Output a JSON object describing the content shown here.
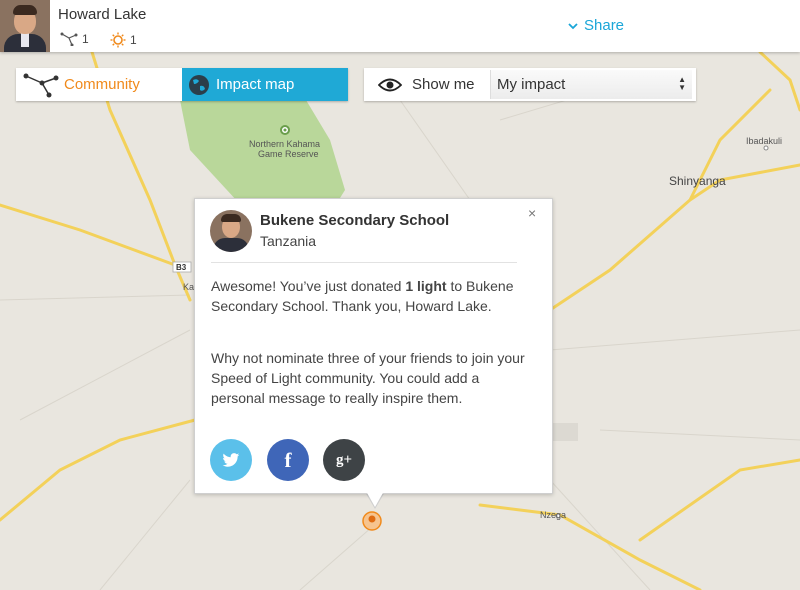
{
  "header": {
    "user_name": "Howard Lake",
    "community_count": "1",
    "lights_count": "1",
    "share_label": "Share"
  },
  "tabs": {
    "community_label": "Community",
    "impact_map_label": "Impact map"
  },
  "show_me": {
    "label": "Show me",
    "selected": "My impact"
  },
  "map_labels": {
    "reserve_line1": "Northern Kahama",
    "reserve_line2": "Game Reserve",
    "shinyanga": "Shinyanga",
    "ibadakuli": "Ibadakuli",
    "nzega": "Nzega",
    "road_b3": "B3",
    "ka": "Ka"
  },
  "popup": {
    "title": "Bukene Secondary School",
    "country": "Tanzania",
    "msg_prefix": "Awesome! You’ve just donated ",
    "msg_bold": "1 light",
    "msg_suffix": " to Bukene Secondary School. Thank you, Howard Lake.",
    "msg2": "Why not nominate three of your friends to join your Speed of Light community. You could add a personal message to really inspire them.",
    "close_glyph": "×",
    "fb_glyph": "f",
    "gp_glyph": "g+"
  },
  "colors": {
    "accent_blue": "#1fa9d6",
    "accent_orange": "#f08a1c",
    "twitter": "#5bc0ea",
    "facebook": "#3f66b8",
    "googleplus": "#3e4346",
    "road_yellow": "#f3d15a",
    "reserve_green": "#b9d79a"
  },
  "icons": {
    "community": "community-network-icon",
    "light": "sun-light-icon",
    "share": "chevron-down-icon",
    "globe": "globe-icon",
    "eye": "eye-icon",
    "close": "close-icon",
    "twitter": "twitter-icon",
    "facebook": "facebook-icon",
    "googleplus": "google-plus-icon",
    "marker": "map-marker-icon"
  }
}
